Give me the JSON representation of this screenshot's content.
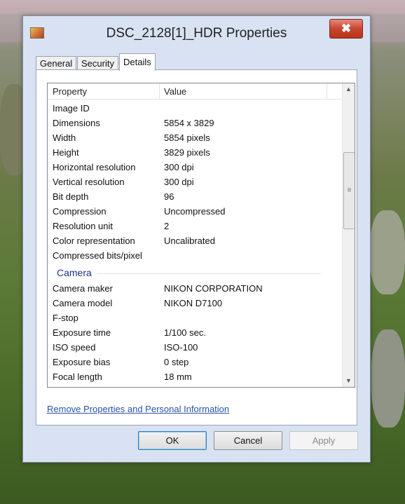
{
  "window": {
    "title": "DSC_2128[1]_HDR Properties",
    "close_label": "✖"
  },
  "tabs": [
    {
      "label": "General"
    },
    {
      "label": "Security"
    },
    {
      "label": "Details",
      "active": true
    }
  ],
  "list": {
    "header": {
      "property": "Property",
      "value": "Value"
    },
    "image_rows": [
      {
        "k": "Image ID",
        "v": ""
      },
      {
        "k": "Dimensions",
        "v": "5854 x 3829"
      },
      {
        "k": "Width",
        "v": "5854 pixels"
      },
      {
        "k": "Height",
        "v": "3829 pixels"
      },
      {
        "k": "Horizontal resolution",
        "v": "300 dpi"
      },
      {
        "k": "Vertical resolution",
        "v": "300 dpi"
      },
      {
        "k": "Bit depth",
        "v": "96"
      },
      {
        "k": "Compression",
        "v": "Uncompressed"
      },
      {
        "k": "Resolution unit",
        "v": "2"
      },
      {
        "k": "Color representation",
        "v": "Uncalibrated"
      },
      {
        "k": "Compressed bits/pixel",
        "v": ""
      }
    ],
    "camera_group": "Camera",
    "camera_rows": [
      {
        "k": "Camera maker",
        "v": "NIKON CORPORATION"
      },
      {
        "k": "Camera model",
        "v": "NIKON D7100"
      },
      {
        "k": "F-stop",
        "v": ""
      },
      {
        "k": "Exposure time",
        "v": "1/100 sec."
      },
      {
        "k": "ISO speed",
        "v": "ISO-100"
      },
      {
        "k": "Exposure bias",
        "v": "0 step"
      },
      {
        "k": "Focal length",
        "v": "18 mm"
      }
    ]
  },
  "link": {
    "remove_label": "Remove Properties and Personal Information"
  },
  "buttons": {
    "ok": "OK",
    "cancel": "Cancel",
    "apply": "Apply"
  },
  "icons": {
    "up": "▲",
    "down": "▼",
    "grip": "≡"
  }
}
